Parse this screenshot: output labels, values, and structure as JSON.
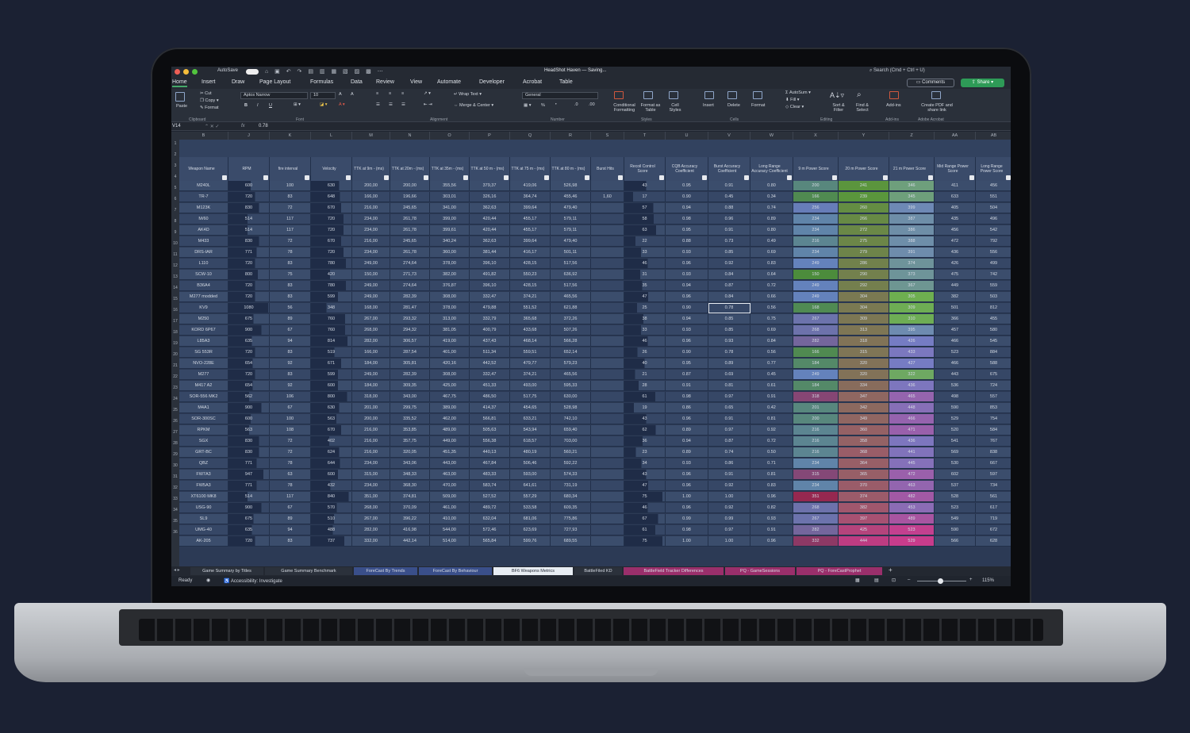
{
  "window": {
    "autosave_label": "AutoSave",
    "title": "HeadShot Haven — Saving...",
    "search_placeholder": "Search (Cmd + Ctrl + U)"
  },
  "colors": {
    "traffic_red": "#ee5f56",
    "traffic_yellow": "#f4bd3b",
    "traffic_green": "#52c43e",
    "share_green": "#2e9b57",
    "header_band": "#3a4b6a"
  },
  "ribbon_tabs": [
    "Home",
    "Insert",
    "Draw",
    "Page Layout",
    "Formulas",
    "Data",
    "Review",
    "View",
    "Automate",
    "Developer",
    "Acrobat",
    "Table"
  ],
  "ribbon_buttons": {
    "comments": "Comments",
    "share": "Share"
  },
  "ribbon": {
    "paste": "Paste",
    "cut": "Cut",
    "copy": "Copy",
    "format": "Format",
    "font_name": "Aptos Narrow",
    "font_size": "10",
    "bold": "B",
    "italic": "I",
    "underline": "U",
    "wrap_text": "Wrap Text",
    "merge_center": "Merge & Center",
    "number_format": "General",
    "percent": "%",
    "conditional_formatting": "Conditional Formatting",
    "format_as_table": "Format as Table",
    "cell_styles": "Cell Styles",
    "insert": "Insert",
    "delete": "Delete",
    "format_cells": "Format",
    "autosum": "AutoSum",
    "fill": "Fill",
    "clear": "Clear",
    "sort_filter": "Sort & Filter",
    "find_select": "Find & Select",
    "add_ins": "Add-ins",
    "create_pdf": "Create PDF and share link",
    "groups": {
      "clipboard": "Clipboard",
      "font": "Font",
      "alignment": "Alignment",
      "number": "Number",
      "styles": "Styles",
      "cells": "Cells",
      "editing": "Editing",
      "add_ins": "Add-ins",
      "adobe": "Adobe Acrobat"
    }
  },
  "formula_bar": {
    "cell_ref": "V14",
    "fx": "fx",
    "value": "0.78"
  },
  "column_letters": [
    "B",
    "J",
    "K",
    "L",
    "M",
    "N",
    "O",
    "P",
    "Q",
    "R",
    "S",
    "T",
    "U",
    "V",
    "W",
    "X",
    "Y",
    "Z",
    "AA",
    "AB"
  ],
  "row_numbers": [
    "1",
    "2",
    "3",
    "4",
    "5",
    "6",
    "7",
    "8",
    "9",
    "10",
    "11",
    "12",
    "13",
    "14",
    "15",
    "16",
    "17",
    "18",
    "19",
    "20",
    "21",
    "22",
    "23",
    "24",
    "25",
    "26",
    "27",
    "28",
    "29",
    "30",
    "31",
    "32",
    "33",
    "34",
    "35",
    "36"
  ],
  "headers": [
    "Weapon Name",
    "RPM",
    "fire interval",
    "Velocity",
    "TTK at 9m - (ms)",
    "TTK at 20m - (ms)",
    "TTK at 35m - (ms)",
    "TTK at 50 m - (ms)",
    "TTK at 75 m - (ms)",
    "TTK at 80 m - (ms)",
    "Burst Hits",
    "Recoil Control Score",
    "CQB Accuracy Coefficient",
    "Burst Accuracy Coefficient",
    "Long Range Accuracy Coefficient",
    "9 m Power Score",
    "20 m Power Score",
    "21 m Power Score",
    "Mid Range Power Score",
    "Long Range Power Score"
  ],
  "rows": [
    [
      "M240L",
      "600",
      "100",
      "630",
      "200,00",
      "200,00",
      "355,56",
      "379,37",
      "419,06",
      "526,98",
      "",
      "43",
      "0.95",
      "0.91",
      "0.80",
      "200",
      "241",
      "346",
      "411",
      "456"
    ],
    [
      "TR-7",
      "720",
      "83",
      "648",
      "166,00",
      "196,66",
      "303,01",
      "326,16",
      "364,74",
      "455,46",
      "1,60",
      "17",
      "0.90",
      "0.45",
      "0.34",
      "166",
      "239",
      "345",
      "633",
      "551"
    ],
    [
      "M123K",
      "830",
      "72",
      "670",
      "216,00",
      "245,65",
      "341,00",
      "362,63",
      "399,64",
      "479,40",
      "",
      "57",
      "0.94",
      "0.88",
      "0.74",
      "256",
      "260",
      "399",
      "405",
      "504"
    ],
    [
      "M/60",
      "514",
      "117",
      "720",
      "234,00",
      "261,78",
      "399,00",
      "420,44",
      "455,17",
      "579,11",
      "",
      "58",
      "0.98",
      "0.96",
      "0.89",
      "234",
      "266",
      "387",
      "435",
      "496"
    ],
    [
      "AK4D",
      "514",
      "117",
      "720",
      "234,00",
      "261,78",
      "399,61",
      "420,44",
      "455,17",
      "579,11",
      "",
      "63",
      "0.95",
      "0.91",
      "0.80",
      "234",
      "272",
      "386",
      "456",
      "542"
    ],
    [
      "M433",
      "830",
      "72",
      "670",
      "216,00",
      "245,65",
      "340,24",
      "362,63",
      "399,64",
      "479,40",
      "",
      "22",
      "0.88",
      "0.73",
      "0.49",
      "216",
      "275",
      "388",
      "472",
      "792"
    ],
    [
      "DRS-IAR",
      "771",
      "78",
      "720",
      "234,00",
      "261,78",
      "360,00",
      "381,44",
      "416,17",
      "501,11",
      "",
      "33",
      "0.93",
      "0.85",
      "0.69",
      "234",
      "279",
      "391",
      "436",
      "556"
    ],
    [
      "L110",
      "720",
      "83",
      "780",
      "249,00",
      "274,64",
      "378,00",
      "396,10",
      "428,15",
      "517,56",
      "",
      "46",
      "0.96",
      "0.92",
      "0.83",
      "249",
      "286",
      "374",
      "426",
      "499"
    ],
    [
      "SCW-10",
      "800",
      "75",
      "420",
      "150,00",
      "271,73",
      "382,00",
      "491,82",
      "550,23",
      "636,92",
      "",
      "31",
      "0.93",
      "0.84",
      "0.64",
      "150",
      "290",
      "373",
      "475",
      "742"
    ],
    [
      "B36A4",
      "720",
      "83",
      "780",
      "249,00",
      "274,64",
      "376,87",
      "396,10",
      "428,15",
      "517,56",
      "",
      "35",
      "0.94",
      "0.87",
      "0.72",
      "249",
      "292",
      "367",
      "449",
      "559"
    ],
    [
      "M277 modded",
      "720",
      "83",
      "599",
      "249,00",
      "282,39",
      "308,00",
      "332,47",
      "374,21",
      "465,56",
      "",
      "47",
      "0.96",
      "0.84",
      "0.66",
      "249",
      "304",
      "305",
      "382",
      "503"
    ],
    [
      "KV9",
      "1080",
      "56",
      "348",
      "168,00",
      "281,47",
      "378,00",
      "479,88",
      "551,52",
      "621,88",
      "",
      "25",
      "0.90",
      "0.78",
      "0.56",
      "168",
      "304",
      "309",
      "501",
      "812"
    ],
    [
      "M250",
      "675",
      "89",
      "760",
      "267,00",
      "293,32",
      "313,00",
      "332,79",
      "365,68",
      "372,26",
      "",
      "38",
      "0.94",
      "0.85",
      "0.75",
      "267",
      "309",
      "310",
      "366",
      "455"
    ],
    [
      "KORD 6P67",
      "900",
      "67",
      "760",
      "268,00",
      "294,32",
      "381,05",
      "400,79",
      "433,68",
      "507,26",
      "",
      "33",
      "0.93",
      "0.85",
      "0.69",
      "268",
      "313",
      "395",
      "457",
      "580"
    ],
    [
      "L85A3",
      "635",
      "94",
      "814",
      "282,00",
      "306,57",
      "419,00",
      "437,43",
      "468,14",
      "566,28",
      "",
      "46",
      "0.96",
      "0.93",
      "0.84",
      "282",
      "318",
      "426",
      "466",
      "545"
    ],
    [
      "SG 553R",
      "720",
      "83",
      "519",
      "166,00",
      "287,54",
      "401,00",
      "511,34",
      "559,51",
      "652,14",
      "",
      "26",
      "0.90",
      "0.78",
      "0.56",
      "166",
      "315",
      "433",
      "523",
      "884"
    ],
    [
      "NVO-228E",
      "654",
      "92",
      "671",
      "184,00",
      "305,81",
      "420,16",
      "442,52",
      "479,77",
      "579,23",
      "",
      "40",
      "0.95",
      "0.89",
      "0.77",
      "184",
      "320",
      "427",
      "466",
      "588"
    ],
    [
      "M277",
      "720",
      "83",
      "599",
      "249,00",
      "282,39",
      "308,00",
      "332,47",
      "374,21",
      "465,56",
      "",
      "21",
      "0.87",
      "0.69",
      "0.45",
      "249",
      "320",
      "322",
      "443",
      "675"
    ],
    [
      "M417 A2",
      "654",
      "92",
      "600",
      "184,00",
      "309,35",
      "425,00",
      "451,33",
      "493,00",
      "595,33",
      "",
      "28",
      "0.91",
      "0.81",
      "0.61",
      "184",
      "334",
      "436",
      "536",
      "724"
    ],
    [
      "SOR-556 MK2",
      "562",
      "106",
      "800",
      "318,00",
      "343,00",
      "467,75",
      "486,50",
      "517,75",
      "630,00",
      "",
      "61",
      "0.98",
      "0.97",
      "0.91",
      "318",
      "347",
      "465",
      "498",
      "557"
    ],
    [
      "M4A1",
      "900",
      "67",
      "630",
      "201,00",
      "299,75",
      "389,00",
      "414,37",
      "454,65",
      "528,98",
      "",
      "19",
      "0.86",
      "0.65",
      "0.42",
      "201",
      "342",
      "448",
      "590",
      "853"
    ],
    [
      "SOR-300SC",
      "600",
      "100",
      "563",
      "200,00",
      "335,52",
      "462,00",
      "566,81",
      "633,21",
      "742,10",
      "",
      "43",
      "0.96",
      "0.91",
      "0.81",
      "200",
      "349",
      "466",
      "529",
      "754"
    ],
    [
      "RPKM",
      "563",
      "108",
      "670",
      "216,00",
      "353,85",
      "489,00",
      "505,63",
      "543,94",
      "659,40",
      "",
      "62",
      "0.89",
      "0.97",
      "0.92",
      "216",
      "360",
      "471",
      "520",
      "584"
    ],
    [
      "SGX",
      "830",
      "72",
      "402",
      "216,00",
      "357,75",
      "449,00",
      "556,38",
      "618,57",
      "703,00",
      "",
      "36",
      "0.94",
      "0.87",
      "0.72",
      "216",
      "358",
      "436",
      "541",
      "767"
    ],
    [
      "GRT-BC",
      "830",
      "72",
      "624",
      "216,00",
      "320,05",
      "451,35",
      "440,13",
      "480,19",
      "560,21",
      "",
      "23",
      "0.89",
      "0.74",
      "0.50",
      "216",
      "368",
      "441",
      "569",
      "838"
    ],
    [
      "QBZ",
      "771",
      "78",
      "644",
      "234,00",
      "343,06",
      "443,00",
      "467,84",
      "506,46",
      "592,22",
      "",
      "34",
      "0.93",
      "0.86",
      "0.71",
      "234",
      "364",
      "445",
      "530",
      "667"
    ],
    [
      "FW7A3",
      "947",
      "63",
      "600",
      "315,00",
      "348,33",
      "463,00",
      "483,33",
      "593,00",
      "574,33",
      "",
      "43",
      "0.96",
      "0.91",
      "0.81",
      "315",
      "365",
      "472",
      "602",
      "597"
    ],
    [
      "FW5A3",
      "771",
      "78",
      "432",
      "234,00",
      "368,30",
      "470,00",
      "583,74",
      "641,61",
      "731,19",
      "",
      "47",
      "0.96",
      "0.92",
      "0.83",
      "234",
      "370",
      "463",
      "537",
      "734"
    ],
    [
      "XT6100 MK8",
      "514",
      "117",
      "840",
      "351,00",
      "374,81",
      "509,00",
      "527,52",
      "557,29",
      "680,34",
      "",
      "75",
      "1.00",
      "1.00",
      "0.96",
      "351",
      "374",
      "482",
      "528",
      "561"
    ],
    [
      "USG-90",
      "900",
      "67",
      "570",
      "268,00",
      "370,09",
      "461,00",
      "489,72",
      "533,58",
      "609,35",
      "",
      "46",
      "0.96",
      "0.92",
      "0.82",
      "268",
      "382",
      "453",
      "523",
      "617"
    ],
    [
      "SL9",
      "675",
      "89",
      "510",
      "267,00",
      "396,22",
      "410,00",
      "632,04",
      "681,06",
      "775,86",
      "",
      "67",
      "0.99",
      "0.99",
      "0.93",
      "267",
      "397",
      "489",
      "549",
      "719"
    ],
    [
      "UMG-40",
      "635",
      "94",
      "488",
      "282,00",
      "416,98",
      "544,00",
      "572,46",
      "623,69",
      "727,93",
      "",
      "61",
      "0.98",
      "0.97",
      "0.91",
      "282",
      "425",
      "523",
      "590",
      "672"
    ],
    [
      "AK-205",
      "720",
      "83",
      "737",
      "332,00",
      "442,14",
      "514,00",
      "565,84",
      "599,76",
      "689,55",
      "",
      "75",
      "1.00",
      "1.00",
      "0.96",
      "332",
      "444",
      "529",
      "566",
      "628"
    ]
  ],
  "selected_cell": {
    "row": 11,
    "col": 13
  },
  "sheet_tabs": [
    {
      "name": "Game Summary by Titles",
      "color": "#2b313b",
      "active": false
    },
    {
      "name": "Game Summary Benchmark",
      "color": "#2b313b",
      "active": false
    },
    {
      "name": "ForeCast By Trends",
      "color": "#3a4f8a",
      "active": false
    },
    {
      "name": "ForeCast By Behaviour",
      "color": "#3a4f8a",
      "active": false
    },
    {
      "name": "BF6 Weapons Metrics",
      "color": "#e8edf3",
      "active": true
    },
    {
      "name": "BattleFiled KD",
      "color": "#2b313b",
      "active": false
    },
    {
      "name": "BattleField Tracker Differences",
      "color": "#9a2f6b",
      "active": false
    },
    {
      "name": "PQ - GameSessions",
      "color": "#9a2f6b",
      "active": false
    },
    {
      "name": "PQ - ForeCastProphet",
      "color": "#9a2f6b",
      "active": false
    }
  ],
  "status": {
    "ready": "Ready",
    "accessibility": "Accessibility: Investigate",
    "zoom": "115%"
  }
}
